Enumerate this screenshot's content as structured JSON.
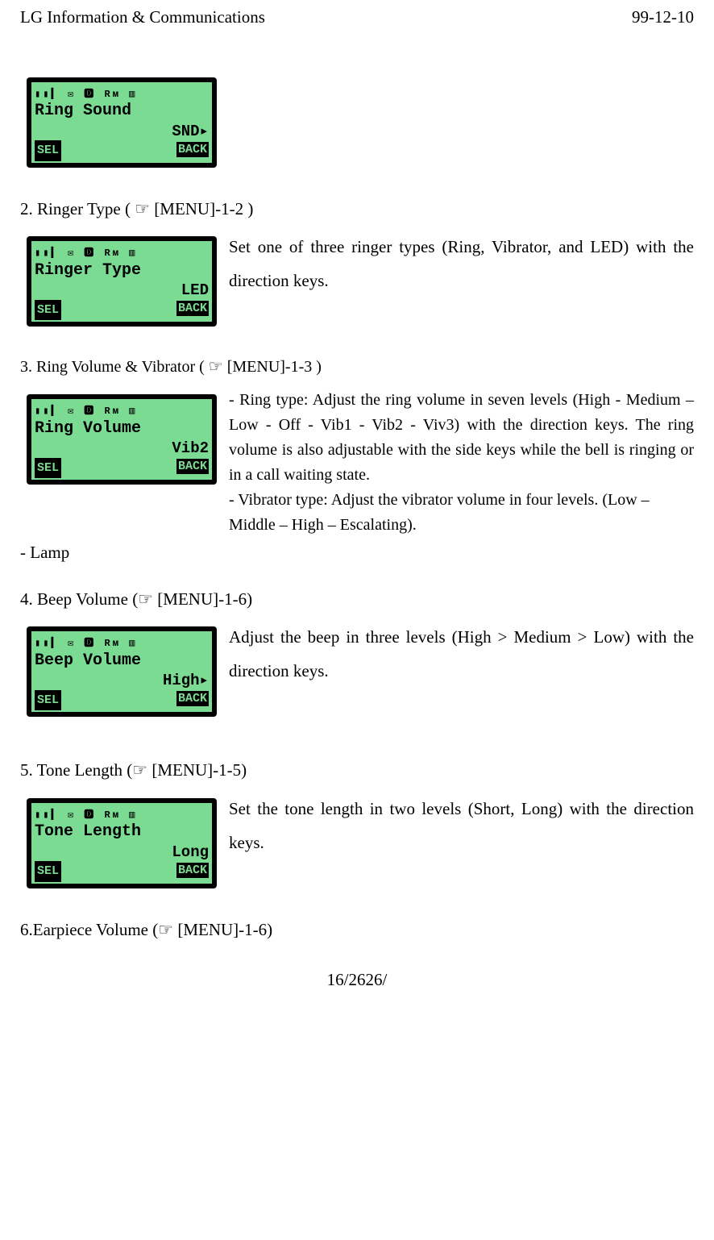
{
  "header": {
    "left": "LG Information & Communications",
    "right": "99-12-10"
  },
  "lcd_status": "▮▮▍  ✉ 🅳 Rᴍ ▥",
  "lcd": {
    "sound": {
      "title": "Ring Sound",
      "value": "SND▸",
      "sel": "SEL",
      "back": "BACK"
    },
    "ringer": {
      "title": "Ringer Type",
      "value": "LED",
      "sel": "SEL",
      "back": "BACK"
    },
    "volume": {
      "title": "Ring Volume",
      "value": "Vib2",
      "sel": "SEL",
      "back": "BACK"
    },
    "beep": {
      "title": "Beep Volume",
      "value": "High▸",
      "sel": "SEL",
      "back": "BACK"
    },
    "tone": {
      "title": "Tone Length",
      "value": "Long",
      "sel": "SEL",
      "back": "BACK"
    }
  },
  "sections": {
    "ringer_heading": "2.  Ringer Type ( ☞ [MENU]-1-2 )",
    "ringer_text": "Set one of three ringer types (Ring, Vibrator, and LED) with the direction keys.",
    "volume_heading": "3.  Ring Volume & Vibrator ( ☞ [MENU]-1-3 )",
    "volume_text1": "- Ring type: Adjust the ring volume in seven levels (High - Medium – Low - Off - Vib1 - Vib2 - Viv3) with the direction keys. The ring volume is also adjustable with the side keys while the bell is ringing or in a call waiting state.",
    "volume_text2": "- Vibrator type: Adjust the vibrator volume in four levels. (Low – Middle – High – Escalating).",
    "lamp": "- Lamp",
    "beep_heading": "4. Beep Volume (☞ [MENU]-1-6)",
    "beep_text": "Adjust the beep in three levels (High > Medium > Low) with the direction keys.",
    "tone_heading": "5. Tone Length (☞ [MENU]-1-5)",
    "tone_text": "Set the tone length in two levels (Short, Long) with the direction keys.",
    "earpiece_heading": "6.Earpiece Volume (☞ [MENU]-1-6)"
  },
  "footer": "16/2626/"
}
